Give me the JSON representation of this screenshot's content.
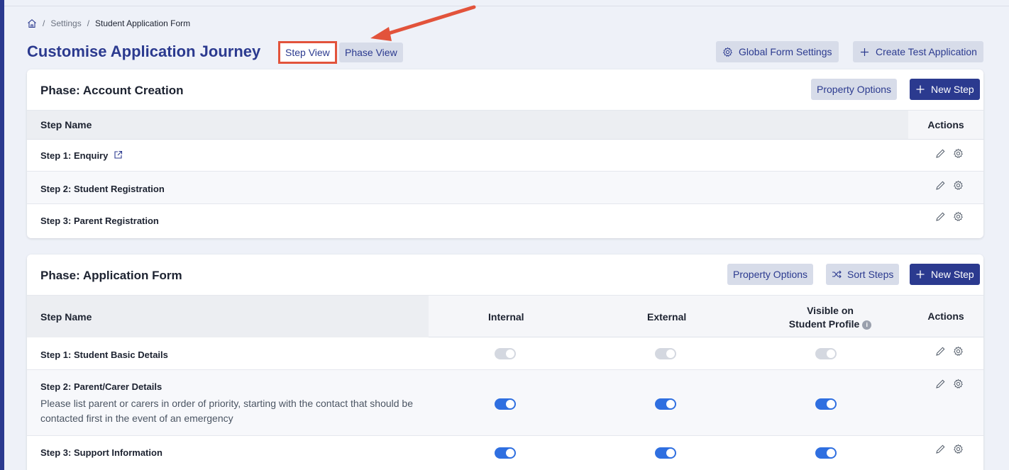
{
  "breadcrumb": {
    "sep": "/",
    "settings": "Settings",
    "current": "Student Application Form"
  },
  "header": {
    "title": "Customise Application Journey",
    "step_view": "Step View",
    "phase_view": "Phase View",
    "global_settings": "Global Form Settings",
    "create_test": "Create Test Application"
  },
  "phase1": {
    "title": "Phase: Account Creation",
    "property_options": "Property Options",
    "new_step": "New Step",
    "col_step": "Step Name",
    "col_actions": "Actions",
    "rows": [
      {
        "name": "Step 1: Enquiry"
      },
      {
        "name": "Step 2: Student Registration"
      },
      {
        "name": "Step 3: Parent Registration"
      }
    ]
  },
  "phase2": {
    "title": "Phase: Application Form",
    "property_options": "Property Options",
    "sort_steps": "Sort Steps",
    "new_step": "New Step",
    "col_step": "Step Name",
    "col_internal": "Internal",
    "col_external": "External",
    "col_visible_1": "Visible on",
    "col_visible_2": "Student Profile",
    "col_actions": "Actions",
    "rows": [
      {
        "name": "Step 1: Student Basic Details",
        "desc": "",
        "internal": false,
        "external": false,
        "visible": false,
        "disabled": true
      },
      {
        "name": "Step 2: Parent/Carer Details",
        "desc": "Please list parent or carers in order of priority, starting with the contact that should be contacted first in the event of an emergency",
        "internal": true,
        "external": true,
        "visible": true,
        "disabled": false
      },
      {
        "name": "Step 3: Support Information",
        "desc": "",
        "internal": true,
        "external": true,
        "visible": true,
        "disabled": false
      }
    ]
  },
  "colors": {
    "primary": "#2b3a8f",
    "toggle_on": "#2f6fe0",
    "highlight": "#e2533b"
  },
  "icons": [
    "home-icon",
    "gear-icon",
    "plus-icon",
    "external-link-icon",
    "pencil-icon",
    "shuffle-icon",
    "info-icon"
  ]
}
